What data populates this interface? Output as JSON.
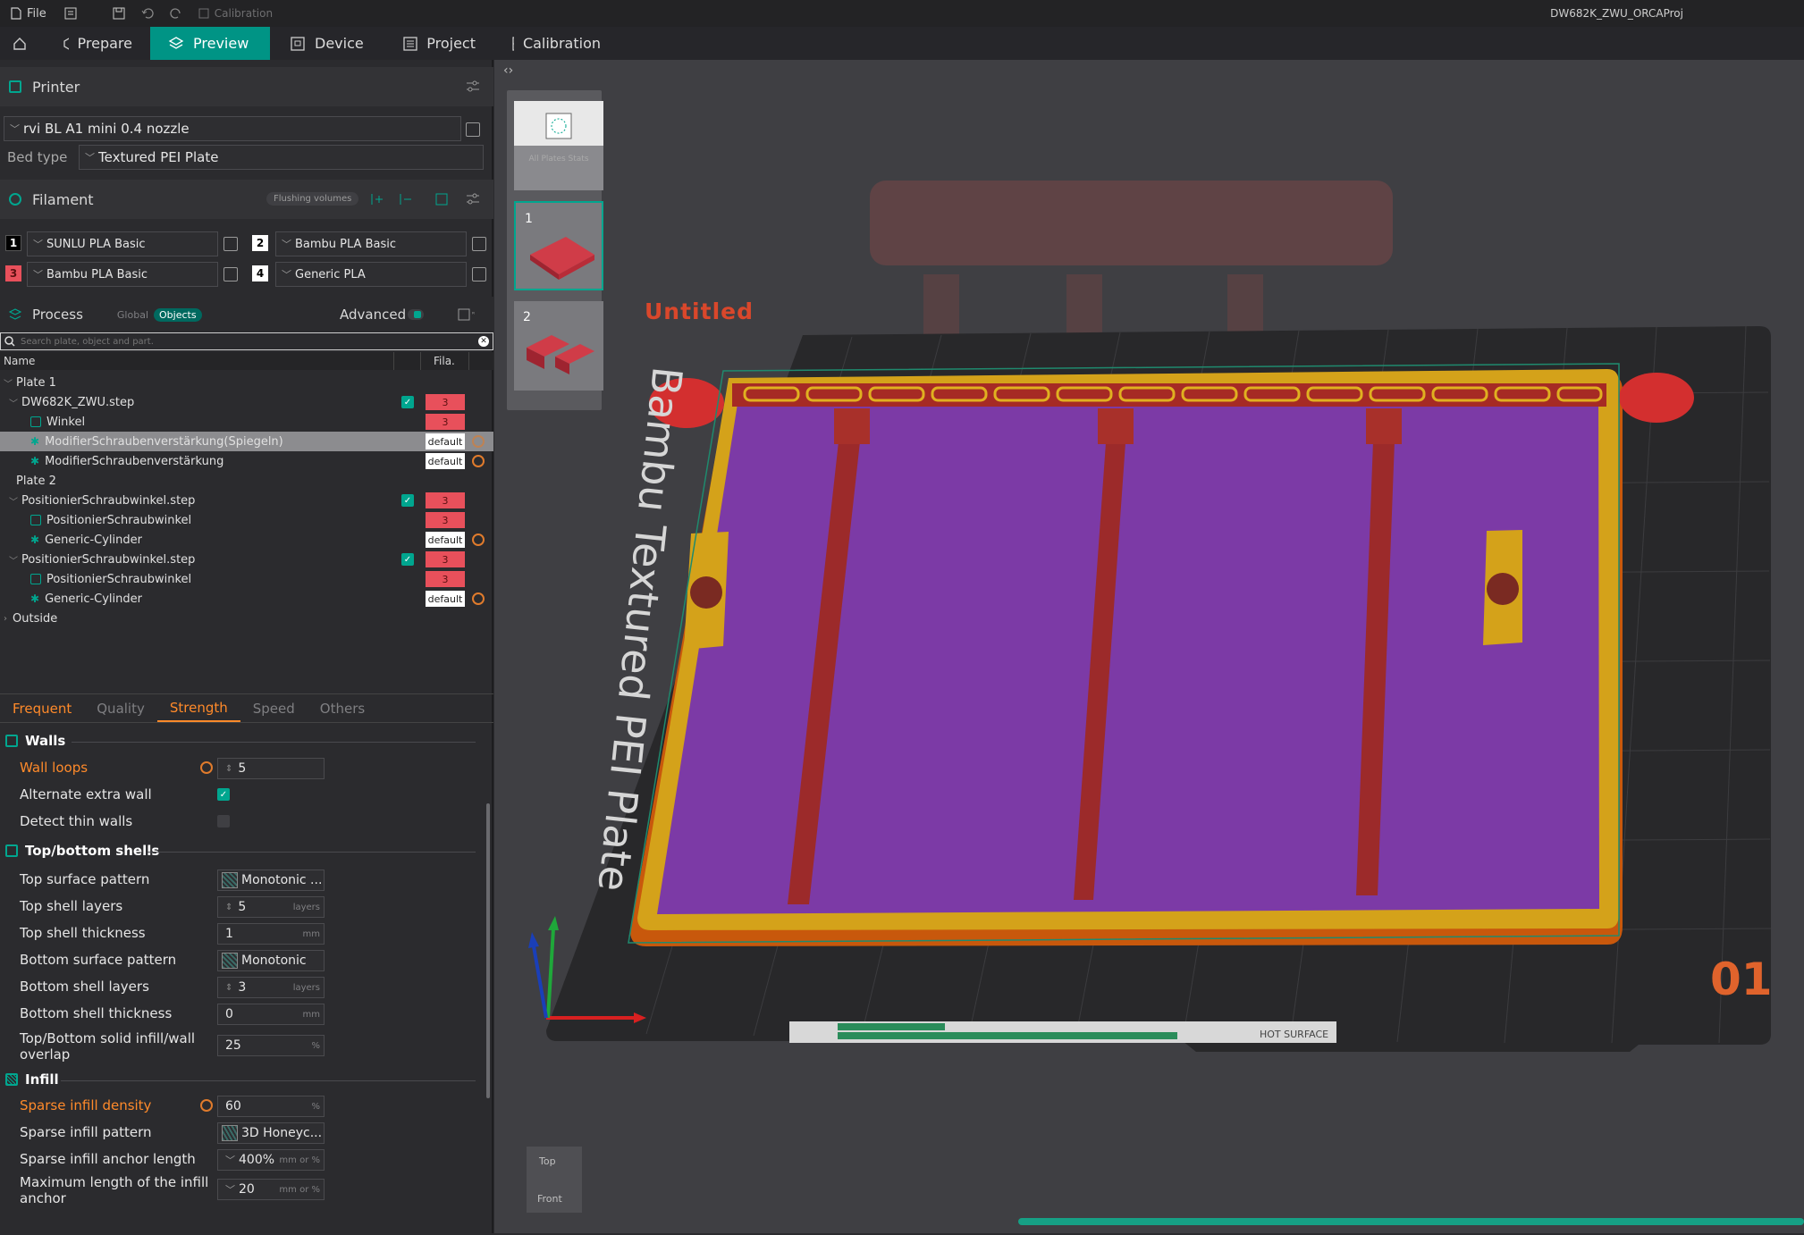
{
  "titlebar": {
    "file_label": "File",
    "calibration_label": "Calibration",
    "project_title": "DW682K_ZWU_ORCAProj"
  },
  "tabs": [
    {
      "label": "Prepare"
    },
    {
      "label": "Preview"
    },
    {
      "label": "Device"
    },
    {
      "label": "Project"
    },
    {
      "label": "Calibration"
    }
  ],
  "printer": {
    "section_label": "Printer",
    "preset": "rvi BL A1 mini 0.4 nozzle",
    "bed_type_label": "Bed type",
    "bed_type": "Textured PEI Plate"
  },
  "filament": {
    "section_label": "Filament",
    "flushing_label": "Flushing volumes",
    "items": [
      {
        "num": "1",
        "name": "SUNLU PLA Basic",
        "color": "#000000"
      },
      {
        "num": "2",
        "name": "Bambu PLA Basic",
        "color": "#ffffff"
      },
      {
        "num": "3",
        "name": "Bambu PLA Basic",
        "color": "#e8505b"
      },
      {
        "num": "4",
        "name": "Generic PLA",
        "color": "#ffffff"
      }
    ]
  },
  "process": {
    "section_label": "Process",
    "global_label": "Global",
    "objects_label": "Objects",
    "advanced_label": "Advanced",
    "search_placeholder": "Search plate, object and part."
  },
  "object_list": {
    "col_name": "Name",
    "col_fila": "Fila.",
    "rows": [
      {
        "label": "Plate 1",
        "fila": ""
      },
      {
        "label": "DW682K_ZWU.step",
        "fila": "3"
      },
      {
        "label": "Winkel",
        "fila": "3"
      },
      {
        "label": "ModifierSchraubenverstärkung(Spiegeln)",
        "fila": "default"
      },
      {
        "label": "ModifierSchraubenverstärkung",
        "fila": "default"
      },
      {
        "label": "Plate 2",
        "fila": ""
      },
      {
        "label": "PositionierSchraubwinkel.step",
        "fila": "3"
      },
      {
        "label": "PositionierSchraubwinkel",
        "fila": "3"
      },
      {
        "label": "Generic-Cylinder",
        "fila": "default"
      },
      {
        "label": "PositionierSchraubwinkel.step",
        "fila": "3"
      },
      {
        "label": "PositionierSchraubwinkel",
        "fila": "3"
      },
      {
        "label": "Generic-Cylinder",
        "fila": "default"
      },
      {
        "label": "Outside",
        "fila": ""
      }
    ]
  },
  "param_tabs": [
    "Frequent",
    "Quality",
    "Strength",
    "Speed",
    "Others"
  ],
  "walls": {
    "title": "Walls",
    "wall_loops_label": "Wall loops",
    "wall_loops": "5",
    "alternate_label": "Alternate extra wall",
    "detect_thin_label": "Detect thin walls"
  },
  "shells": {
    "title": "Top/bottom shells",
    "top_pattern_label": "Top surface pattern",
    "top_pattern": "Monotonic ...",
    "top_layers_label": "Top shell layers",
    "top_layers": "5",
    "top_thickness_label": "Top shell thickness",
    "top_thickness": "1",
    "bottom_pattern_label": "Bottom surface pattern",
    "bottom_pattern": "Monotonic",
    "bottom_layers_label": "Bottom shell layers",
    "bottom_layers": "3",
    "bottom_thickness_label": "Bottom shell thickness",
    "bottom_thickness": "0",
    "overlap_label_1": "Top/Bottom solid infill/wall",
    "overlap_label_2": "overlap",
    "overlap": "25",
    "unit_layers": "layers",
    "unit_mm": "mm",
    "unit_pct": "%"
  },
  "infill": {
    "title": "Infill",
    "density_label": "Sparse infill density",
    "density": "60",
    "pattern_label": "Sparse infill pattern",
    "pattern": "3D Honeyc...",
    "anchor_label": "Sparse infill anchor length",
    "anchor": "400%",
    "max_anchor_label_1": "Maximum length of the infill",
    "max_anchor_label_2": "anchor",
    "max_anchor": "20",
    "unit_mmpct": "mm or %"
  },
  "viewport": {
    "plate_name": "Untitled",
    "plate_number": "01",
    "bed_text": "Bambu Textured PEI Plate",
    "hot_surface": "HOT SURFACE",
    "cube_top": "Top",
    "cube_front": "Front",
    "thumb_numbers": [
      "1",
      "2"
    ],
    "all_plates_label": "All Plates Stats"
  },
  "colors": {
    "accent": "#009485",
    "modified": "#ff8a2a",
    "filament_red": "#e8505b",
    "infill_purple": "#7c3aa6",
    "part_red": "#b8262d"
  }
}
